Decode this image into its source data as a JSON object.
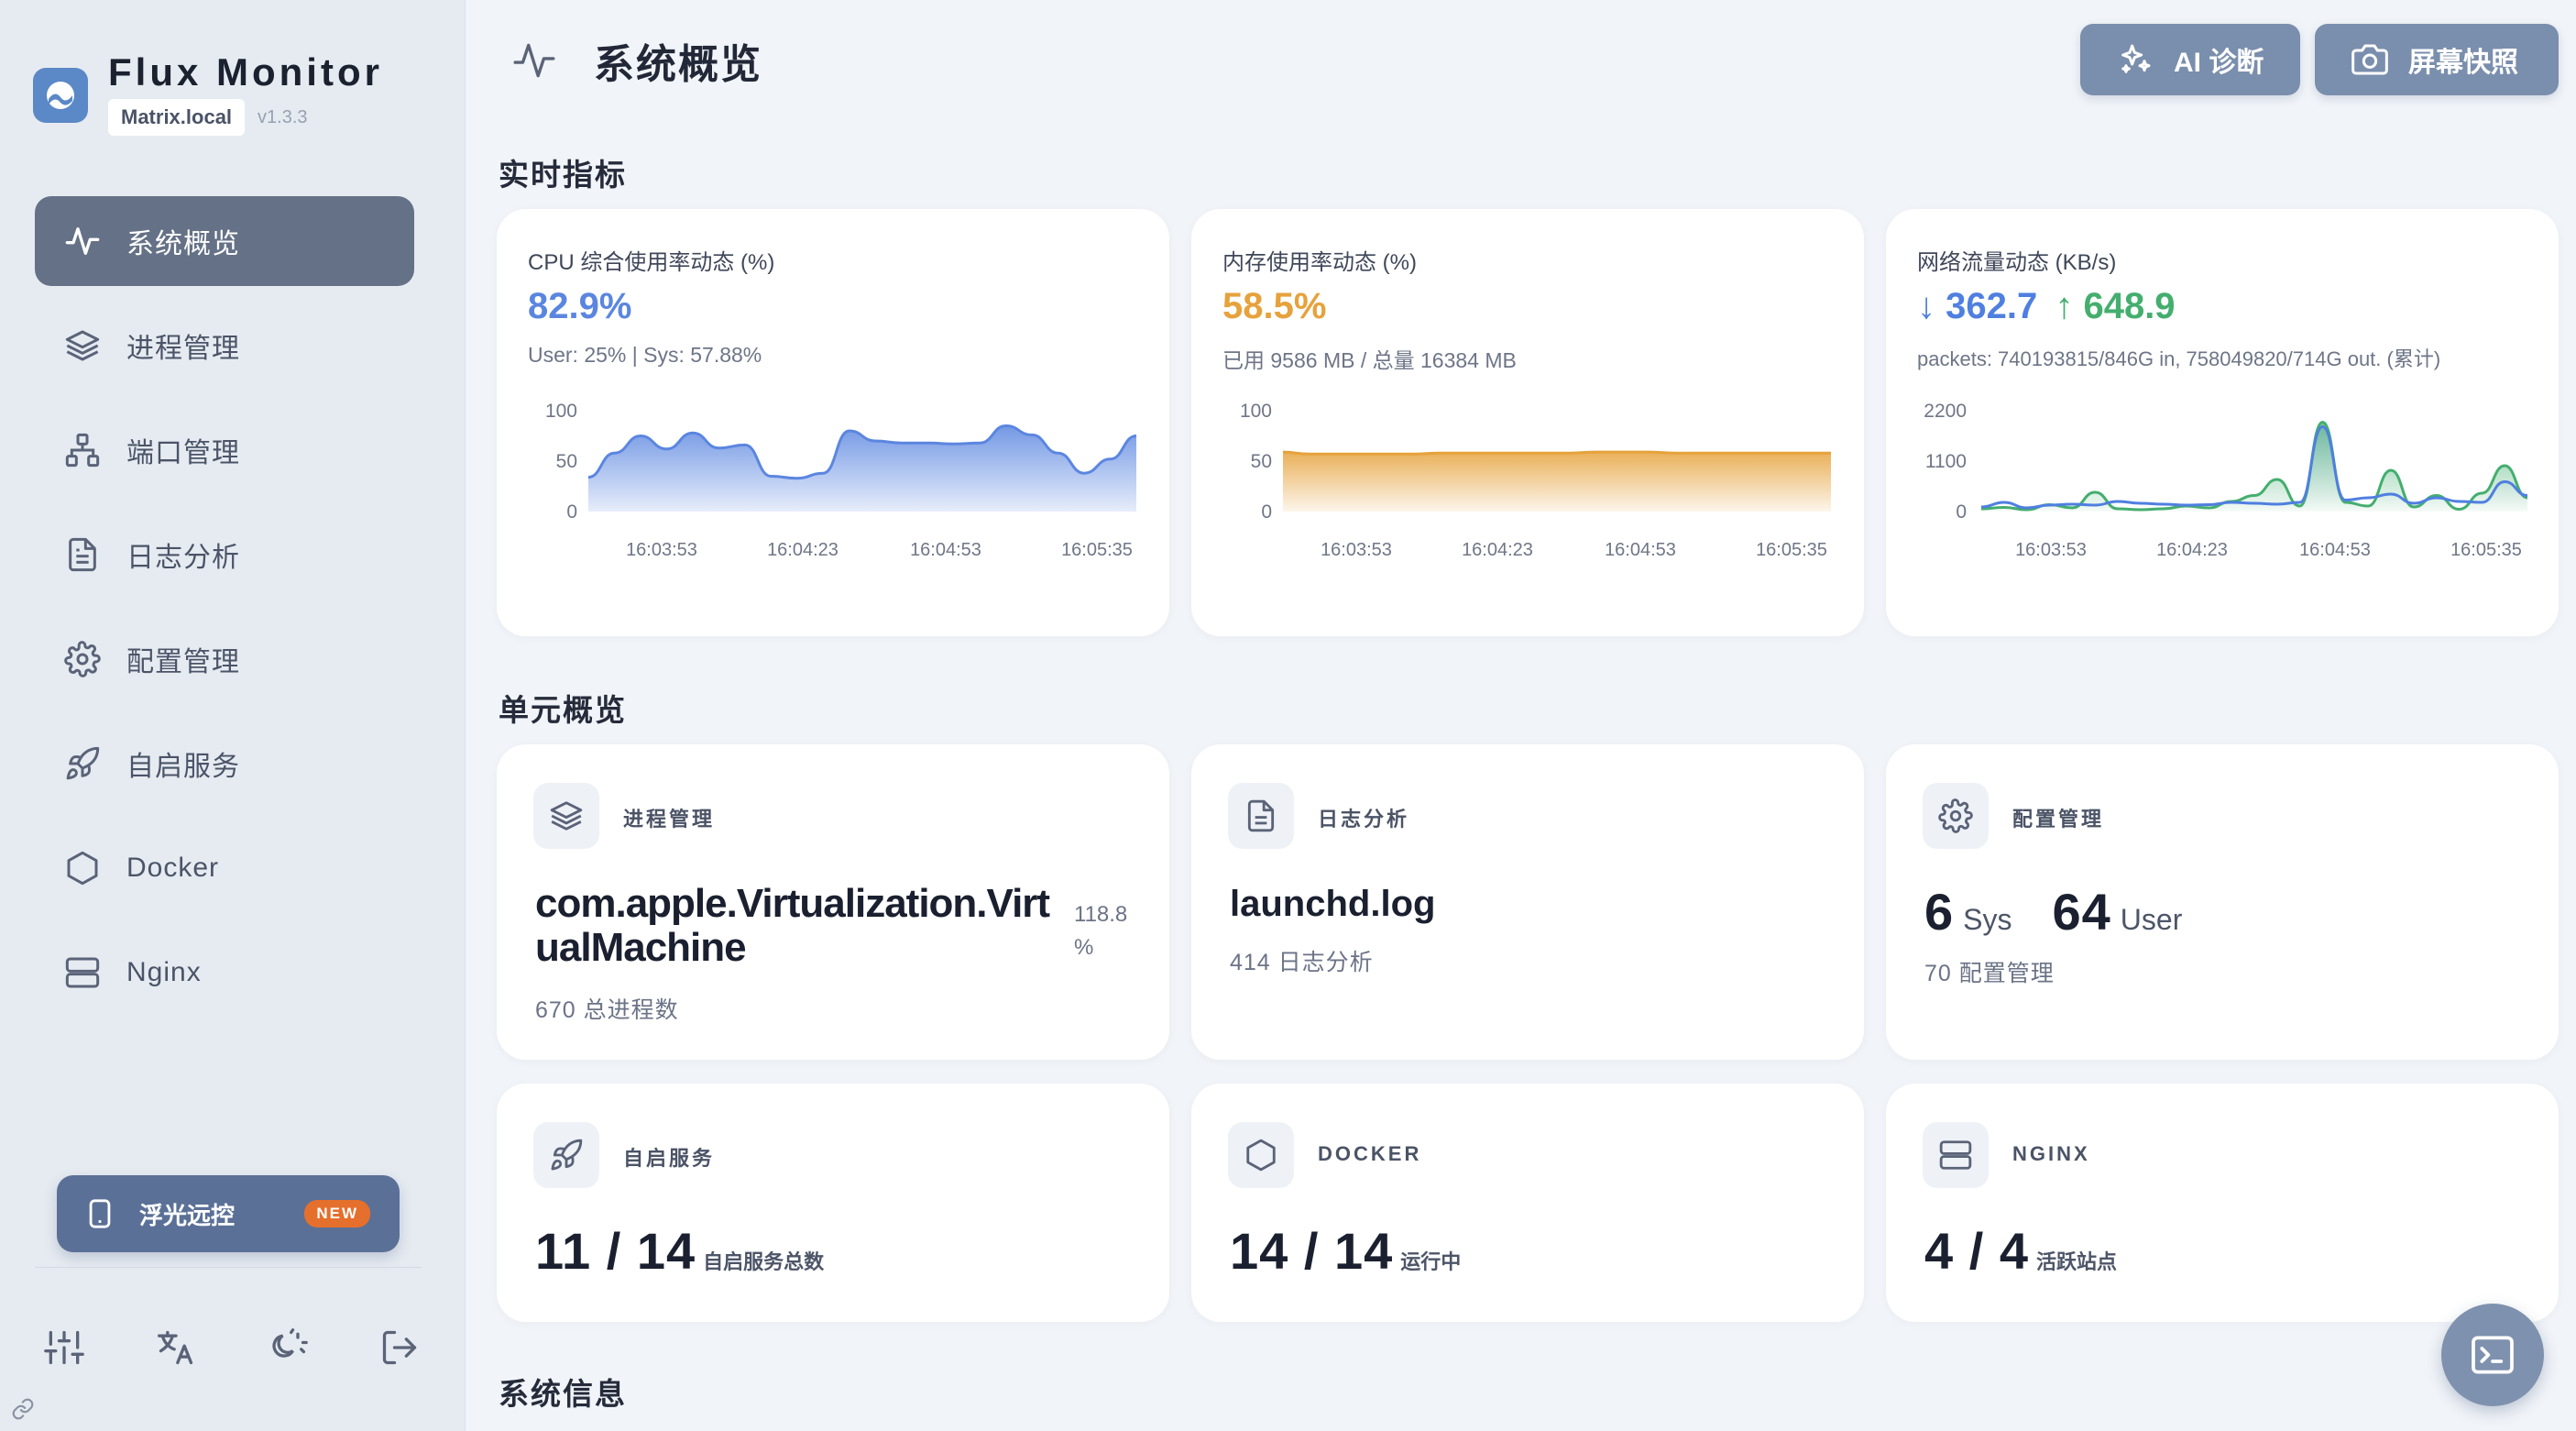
{
  "app": {
    "name": "Flux Monitor",
    "host": "Matrix.local",
    "version": "v1.3.3"
  },
  "sidebar": {
    "items": [
      {
        "label": "系统概览",
        "icon": "activity-icon",
        "active": true
      },
      {
        "label": "进程管理",
        "icon": "layers-icon"
      },
      {
        "label": "端口管理",
        "icon": "network-icon"
      },
      {
        "label": "日志分析",
        "icon": "file-text-icon"
      },
      {
        "label": "配置管理",
        "icon": "gear-icon"
      },
      {
        "label": "自启服务",
        "icon": "rocket-icon"
      },
      {
        "label": "Docker",
        "icon": "hexagon-icon"
      },
      {
        "label": "Nginx",
        "icon": "server-icon"
      }
    ],
    "remote": {
      "label": "浮光远控",
      "badge": "NEW"
    },
    "tools": [
      "sliders-icon",
      "translate-icon",
      "theme-icon",
      "logout-icon"
    ]
  },
  "header": {
    "title": "系统概览",
    "ai_button": "AI 诊断",
    "snapshot_button": "屏幕快照"
  },
  "sections": {
    "realtime": "实时指标",
    "units": "单元概览",
    "sysinfo": "系统信息"
  },
  "metrics": {
    "cpu": {
      "title": "CPU 综合使用率动态 (%)",
      "value": "82.9%",
      "sub": "User: 25% | Sys: 57.88%",
      "color": "#5b86e0"
    },
    "memory": {
      "title": "内存使用率动态 (%)",
      "value": "58.5%",
      "sub": "已用 9586 MB / 总量 16384 MB",
      "color": "#e6a23c"
    },
    "network": {
      "title": "网络流量动态 (KB/s)",
      "down": "↓ 362.7",
      "up": "↑ 648.9",
      "sub": "packets: 740193815/846G in, 758049820/714G out. (累计)",
      "down_color": "#4f7fe0",
      "up_color": "#44ae6e"
    }
  },
  "chart_data": [
    {
      "type": "area",
      "title": "CPU 综合使用率动态 (%)",
      "ylim": [
        0,
        100
      ],
      "yticks": [
        "100",
        "50",
        "0"
      ],
      "xticks": [
        "16:03:53",
        "16:04:23",
        "16:04:53",
        "16:05:35"
      ],
      "series": [
        {
          "values": [
            34,
            58,
            75,
            62,
            78,
            63,
            66,
            35,
            33,
            38,
            80,
            70,
            68,
            68,
            67,
            68,
            85,
            76,
            58,
            38,
            52,
            75
          ]
        }
      ]
    },
    {
      "type": "area",
      "title": "内存使用率动态 (%)",
      "ylim": [
        0,
        100
      ],
      "yticks": [
        "100",
        "50",
        "0"
      ],
      "xticks": [
        "16:03:53",
        "16:04:23",
        "16:04:53",
        "16:05:35"
      ],
      "series": [
        {
          "values": [
            59,
            57,
            57,
            57,
            57,
            57,
            58,
            58,
            58,
            58,
            58,
            58,
            59,
            59,
            59,
            58,
            58,
            58,
            58,
            58,
            58,
            58
          ]
        }
      ]
    },
    {
      "type": "area",
      "title": "网络流量动态 (KB/s)",
      "ylim": [
        0,
        2200
      ],
      "yticks": [
        "2200",
        "1100",
        "0"
      ],
      "xticks": [
        "16:03:53",
        "16:04:23",
        "16:04:53",
        "16:05:35"
      ],
      "series": [
        {
          "values": [
            60,
            90,
            40,
            150,
            80,
            420,
            60,
            40,
            60,
            120,
            80,
            220,
            350,
            700,
            120,
            1950,
            200,
            120,
            900,
            100,
            350,
            50,
            400,
            1000,
            300
          ]
        },
        {
          "values": [
            100,
            200,
            80,
            140,
            160,
            140,
            220,
            180,
            160,
            140,
            150,
            200,
            180,
            160,
            200,
            1850,
            250,
            300,
            380,
            180,
            300,
            220,
            200,
            650,
            350
          ]
        }
      ]
    }
  ],
  "units": {
    "process": {
      "label": "进程管理",
      "name": "com.apple.Virtualization.VirtualMachine",
      "percent": "118.8 %",
      "sub": "670 总进程数"
    },
    "log": {
      "label": "日志分析",
      "name": "launchd.log",
      "sub": "414 日志分析"
    },
    "config": {
      "label": "配置管理",
      "sys": "6",
      "sys_label": "Sys",
      "user": "64",
      "user_label": "User",
      "sub": "70 配置管理"
    },
    "autostart": {
      "label": "自启服务",
      "value": "11 / 14",
      "sub": "自启服务总数"
    },
    "docker": {
      "label": "DOCKER",
      "value": "14 / 14",
      "sub": "运行中"
    },
    "nginx": {
      "label": "NGINX",
      "value": "4 / 4",
      "sub": "活跃站点"
    }
  }
}
